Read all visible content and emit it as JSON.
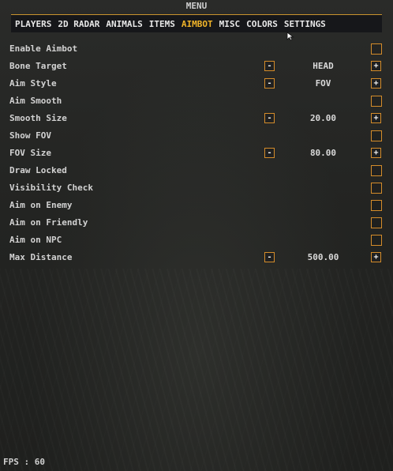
{
  "menu": {
    "title": "MENU"
  },
  "tabs": [
    {
      "label": "PLAYERS"
    },
    {
      "label": "2D RADAR"
    },
    {
      "label": "ANIMALS"
    },
    {
      "label": "ITEMS"
    },
    {
      "label": "AIMBOT"
    },
    {
      "label": "MISC"
    },
    {
      "label": "COLORS"
    },
    {
      "label": "SETTINGS"
    }
  ],
  "active_tab": "AIMBOT",
  "accent_color": "#f0b429",
  "border_color": "#d48c2a",
  "stepper": {
    "minus_label": "-",
    "plus_label": "+"
  },
  "rows": [
    {
      "label": "Enable Aimbot",
      "type": "checkbox",
      "checked": false
    },
    {
      "label": "Bone Target",
      "type": "stepper",
      "value": "HEAD"
    },
    {
      "label": "Aim Style",
      "type": "stepper",
      "value": "FOV"
    },
    {
      "label": "Aim Smooth",
      "type": "checkbox",
      "checked": false
    },
    {
      "label": "Smooth Size",
      "type": "stepper",
      "value": "20.00"
    },
    {
      "label": "Show FOV",
      "type": "checkbox",
      "checked": false
    },
    {
      "label": "FOV Size",
      "type": "stepper",
      "value": "80.00"
    },
    {
      "label": "Draw Locked",
      "type": "checkbox",
      "checked": false
    },
    {
      "label": "Visibility Check",
      "type": "checkbox",
      "checked": false
    },
    {
      "label": "Aim on Enemy",
      "type": "checkbox",
      "checked": false
    },
    {
      "label": "Aim on Friendly",
      "type": "checkbox",
      "checked": false
    },
    {
      "label": "Aim on NPC",
      "type": "checkbox",
      "checked": false
    },
    {
      "label": "Max Distance",
      "type": "stepper",
      "value": "500.00"
    }
  ],
  "fps": {
    "text": "FPS : 60"
  },
  "icons": {
    "cursor": "mouse-cursor-icon"
  }
}
